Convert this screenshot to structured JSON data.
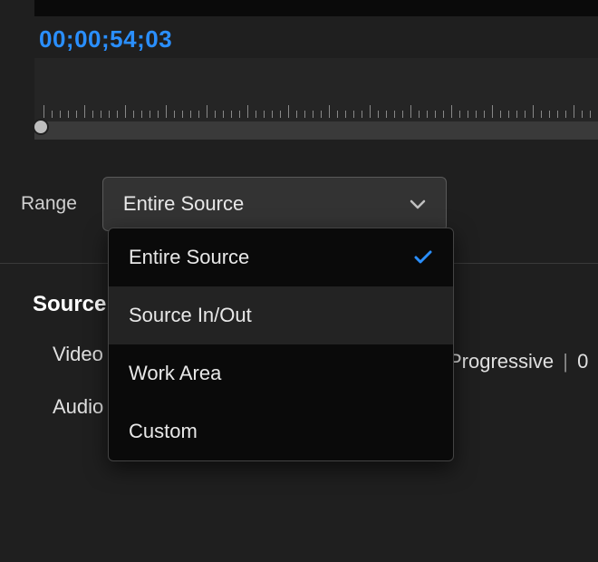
{
  "timecode": "00;00;54;03",
  "range": {
    "label": "Range",
    "selected": "Entire Source",
    "options": [
      {
        "label": "Entire Source",
        "checked": true,
        "highlighted": false
      },
      {
        "label": "Source In/Out",
        "checked": false,
        "highlighted": true
      },
      {
        "label": "Work Area",
        "checked": false,
        "highlighted": false
      },
      {
        "label": "Custom",
        "checked": false,
        "highlighted": false
      }
    ]
  },
  "source": {
    "header": "Source",
    "video_label": "Video",
    "audio_label": "Audio",
    "scan_type": "Progressive",
    "duration_partial": "0"
  }
}
